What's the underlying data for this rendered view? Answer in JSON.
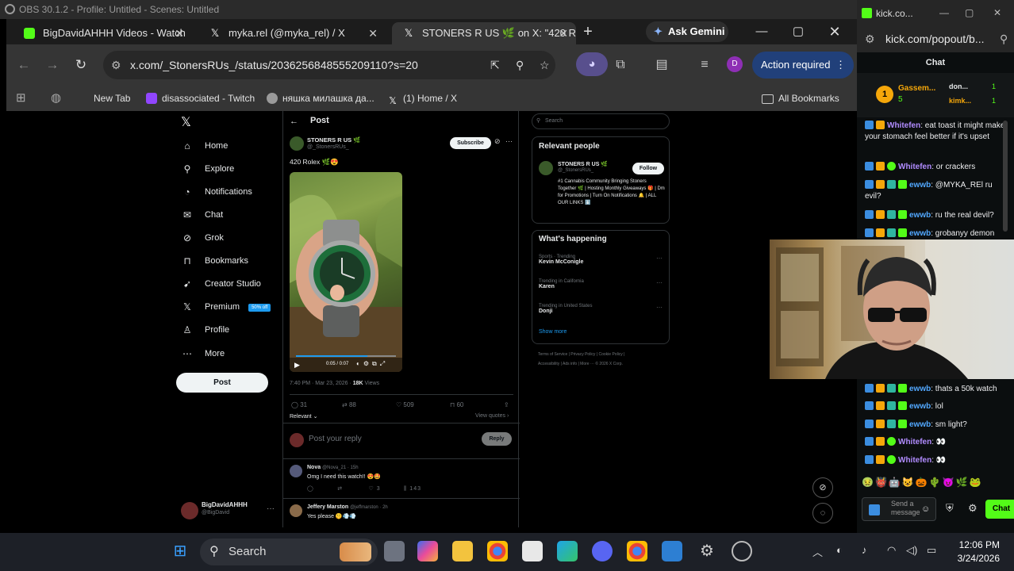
{
  "obs": {
    "title": "OBS 30.1.2 - Profile: Untitled - Scenes: Untitled"
  },
  "browser": {
    "tabs": [
      {
        "label": "BigDavidAHHH Videos - Watch",
        "color": "#53fc18"
      },
      {
        "label": "myka.rel (@myka_rel) / X",
        "color": "#ffffff"
      },
      {
        "label": "STONERS R US 🌿 on X: \"420 R",
        "color": "#ffffff"
      }
    ],
    "new_tab": "+",
    "gemini": "Ask Gemini",
    "gemini_star": "✦",
    "url": "x.com/_StonersRUs_/status/2036256848555209110?s=20",
    "profile_initial": "D",
    "action_required": "Action required",
    "bookmarks": [
      {
        "label": "New Tab",
        "color": "#353535"
      },
      {
        "label": "disassociated - Twitch",
        "color": "#9146ff"
      },
      {
        "label": "няшка милашка да...",
        "color": "#9a9a9a"
      },
      {
        "label": "(1) Home / X",
        "color": "#000000"
      }
    ],
    "all_bookmarks": "All Bookmarks"
  },
  "x": {
    "logo": "𝕏",
    "nav": [
      {
        "label": "Home",
        "icon": "⌂"
      },
      {
        "label": "Explore",
        "icon": "⚲"
      },
      {
        "label": "Notifications",
        "icon": "◔"
      },
      {
        "label": "Chat",
        "icon": "✉"
      },
      {
        "label": "Grok",
        "icon": "⊘"
      },
      {
        "label": "Bookmarks",
        "icon": "⊓"
      },
      {
        "label": "Creator Studio",
        "icon": "➹"
      },
      {
        "label": "Premium",
        "icon": "𝕏"
      },
      {
        "label": "Profile",
        "icon": "♙"
      },
      {
        "label": "More",
        "icon": "⋯"
      }
    ],
    "premium_badge": "50% off",
    "post_button": "Post",
    "account_name": "BigDavidAHHH",
    "account_handle": "@BigDavid",
    "header": "Post",
    "author_name": "STONERS R US 🌿",
    "author_handle": "@_StonersRUs_",
    "subscribe": "Subscribe",
    "tweet_text": "420 Rolex 🌿😍",
    "video_time": "0:05 / 0:07",
    "timestamp": "7:40 PM · Mar 23, 2026 · ",
    "views": "18K",
    "views_label": " Views",
    "stats": {
      "replies": "31",
      "reposts": "88",
      "likes": "509",
      "bookmarks": "60"
    },
    "relevant": "Relevant",
    "view_quotes": "View quotes",
    "reply_placeholder": "Post your reply",
    "reply_button": "Reply",
    "replies": [
      {
        "name": "Nova",
        "handle": "@Nova_21 · 15h",
        "text": "Omg I need this watch!! 😍🤩",
        "likes": "3",
        "views": "143"
      },
      {
        "name": "Jeffery Marston",
        "handle": "@jeffmarston · 2h",
        "text": "Yes please 🤫💨💨"
      }
    ],
    "search_placeholder": "Search",
    "relevant_people": "Relevant people",
    "follow": "Follow",
    "bio": "#1 Cannabis Community Bringing Stoners Together 🌿 | Hosting Monthly Giveaways 🎁 | Dm for Promotions | Turn On Notifications 🔔 | ALL OUR LINKS ⬇️",
    "whats_happening": "What's happening",
    "trends": [
      {
        "context": "Sports · Trending",
        "name": "Kevin McConigle"
      },
      {
        "context": "Trending in California",
        "name": "Karen"
      },
      {
        "context": "Trending in United States",
        "name": "Donji"
      }
    ],
    "show_more": "Show more",
    "footer1": "Terms of Service  |  Privacy Policy  |  Cookie Policy  |",
    "footer2": "Accessibility  |  Ads info  |  More ···  © 2026 X Corp."
  },
  "kick": {
    "title": "kick.co...",
    "url": "kick.com/popout/b...",
    "chat_label": "Chat",
    "top_gifter": "Gassem...",
    "top_gifter_count": "5",
    "gifter2": "don...",
    "gifter2_count": "1",
    "gifter3": "kimk...",
    "gifter3_count": "1",
    "messages": [
      {
        "user": "Whitefen",
        "text": "eat toast it might make your stomach feel better if it's upset",
        "color": "#b18cff"
      },
      {
        "user": "Whitefen",
        "text": "or crackers",
        "color": "#b18cff"
      },
      {
        "user": "ewwb",
        "text": "@MYKA_REl ru evil?",
        "color": "#52a8ff"
      },
      {
        "user": "ewwb",
        "text": "ru the real devil?",
        "color": "#52a8ff"
      },
      {
        "user": "ewwb",
        "text": "grobanyy demon",
        "color": "#52a8ff"
      },
      {
        "user": "ewwb",
        "text": "thats a 50k watch",
        "color": "#52a8ff"
      },
      {
        "user": "ewwb",
        "text": "lol",
        "color": "#52a8ff"
      },
      {
        "user": "ewwb",
        "text": "sm light?",
        "color": "#52a8ff"
      },
      {
        "user": "Whitefen",
        "text": "👀",
        "color": "#b18cff"
      },
      {
        "user": "Whitefen",
        "text": "👀",
        "color": "#b18cff"
      }
    ],
    "send_placeholder": "Send a message",
    "chat_button": "Chat"
  },
  "taskbar": {
    "search": "Search",
    "time": "12:06 PM",
    "date": "3/24/2026"
  }
}
